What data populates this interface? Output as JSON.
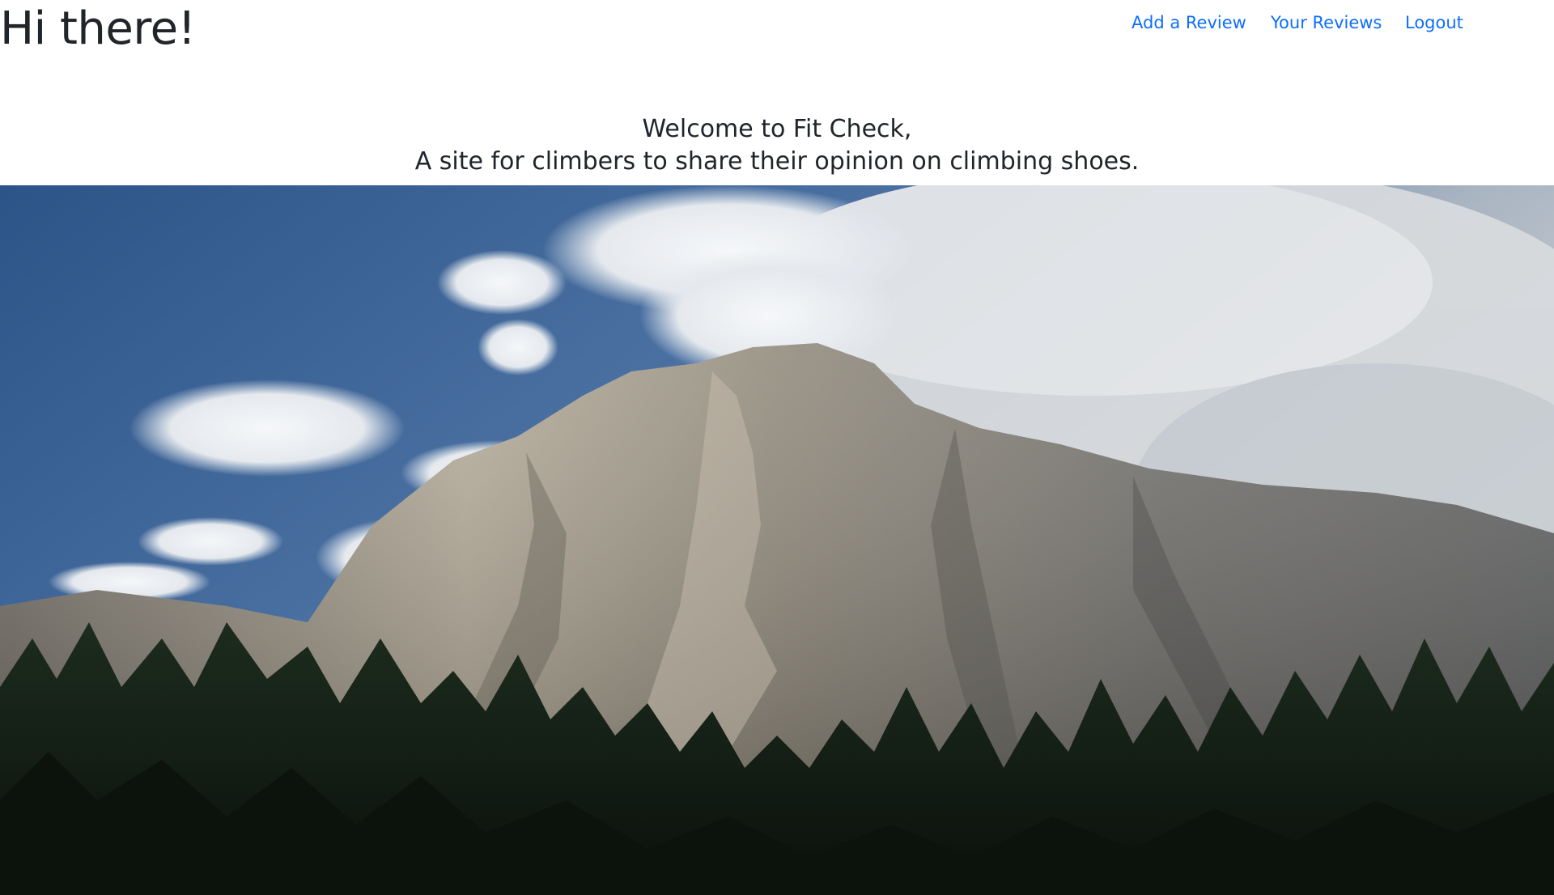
{
  "header": {
    "greeting": "Hi there!"
  },
  "nav": {
    "items": [
      {
        "label": "Add a Review"
      },
      {
        "label": "Your Reviews"
      },
      {
        "label": "Logout"
      }
    ]
  },
  "welcome": {
    "line1": "Welcome to Fit Check,",
    "line2": "A site for climbers to share their opinion on climbing shoes."
  },
  "colors": {
    "link": "#0d6efd",
    "text": "#212529",
    "sky": "#3a6090",
    "rock": "#8a8478",
    "forest": "#0f1a12"
  }
}
